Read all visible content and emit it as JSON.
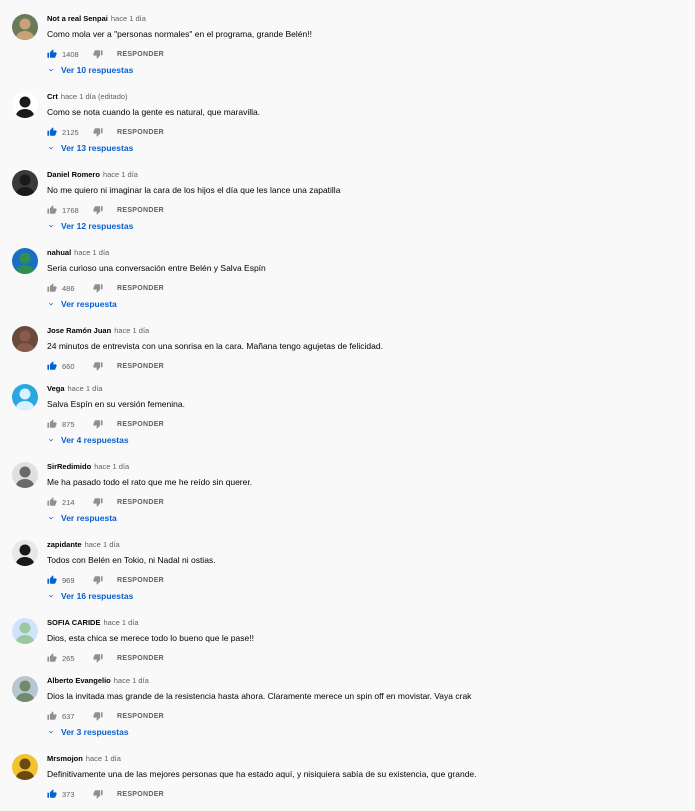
{
  "comments": [
    {
      "author": "Not a real Senpai",
      "time": "hace 1 día",
      "text": "Como mola ver a \"personas normales\" en el programa, grande Belén!!",
      "likes": "1408",
      "liked": true,
      "reply_label": "RESPONDER",
      "replies_label": "Ver 10 respuestas",
      "avatar_icon": "avatar-photo-icon"
    },
    {
      "author": "Crt",
      "time": "hace 1 día (editado)",
      "text": "Como se nota cuando la gente es natural, que maravilla.",
      "likes": "2125",
      "liked": true,
      "reply_label": "RESPONDER",
      "replies_label": "Ver 13 respuestas",
      "avatar_icon": "avatar-photo-icon"
    },
    {
      "author": "Daniel Romero",
      "time": "hace 1 día",
      "text": "No me quiero ni imaginar la cara de los hijos el día que les lance una zapatilla",
      "likes": "1768",
      "liked": false,
      "reply_label": "RESPONDER",
      "replies_label": "Ver 12 respuestas",
      "avatar_icon": "avatar-photo-icon"
    },
    {
      "author": "nahual",
      "time": "hace 1 día",
      "text": "Seria curioso una conversación entre Belén y Salva Espín",
      "likes": "486",
      "liked": false,
      "reply_label": "RESPONDER",
      "replies_label": "Ver respuesta",
      "avatar_icon": "avatar-photo-icon"
    },
    {
      "author": "Jose Ramón Juan",
      "time": "hace 1 día",
      "text": "24 minutos de entrevista con una sonrisa en la cara. Mañana tengo agujetas de felicidad.",
      "likes": "660",
      "liked": true,
      "reply_label": "RESPONDER",
      "replies_label": "",
      "avatar_icon": "avatar-photo-icon"
    },
    {
      "author": "Vega",
      "time": "hace 1 día",
      "text": "Salva Espín en su versión femenina.",
      "likes": "875",
      "liked": false,
      "reply_label": "RESPONDER",
      "replies_label": "Ver 4 respuestas",
      "avatar_icon": "avatar-photo-icon"
    },
    {
      "author": "SirRedimido",
      "time": "hace 1 día",
      "text": "Me ha pasado todo el rato que me he reído sin querer.",
      "likes": "214",
      "liked": false,
      "reply_label": "RESPONDER",
      "replies_label": "Ver respuesta",
      "avatar_icon": "avatar-photo-icon"
    },
    {
      "author": "zapidante",
      "time": "hace 1 día",
      "text": "Todos con Belén en Tokio, ni Nadal ni ostias.",
      "likes": "969",
      "liked": true,
      "reply_label": "RESPONDER",
      "replies_label": "Ver 16 respuestas",
      "avatar_icon": "avatar-photo-icon"
    },
    {
      "author": "SOFIA CARIDE",
      "time": "hace 1 día",
      "text": "Dios, esta chica se merece todo lo bueno que le pase!!",
      "likes": "265",
      "liked": false,
      "reply_label": "RESPONDER",
      "replies_label": "",
      "avatar_icon": "avatar-photo-icon"
    },
    {
      "author": "Alberto Evangelio",
      "time": "hace 1 día",
      "text": "Dios la invitada mas grande de la resistencia hasta ahora. Claramente merece un spin off en movistar. Vaya crak",
      "likes": "637",
      "liked": false,
      "reply_label": "RESPONDER",
      "replies_label": "Ver 3 respuestas",
      "avatar_icon": "avatar-photo-icon"
    },
    {
      "author": "Mrsmojon",
      "time": "hace 1 día",
      "text": "Definitivamente una de las mejores personas que ha estado aquí, y nisiquiera sabía de su existencia, que grande.",
      "likes": "373",
      "liked": true,
      "reply_label": "RESPONDER",
      "replies_label": "",
      "avatar_icon": "avatar-photo-icon"
    }
  ],
  "colors": {
    "background": "#f9f9f9",
    "link_blue": "#065fd4",
    "like_active": "#065fd4",
    "icon_gray": "#909090",
    "secondary_text": "#606060"
  }
}
